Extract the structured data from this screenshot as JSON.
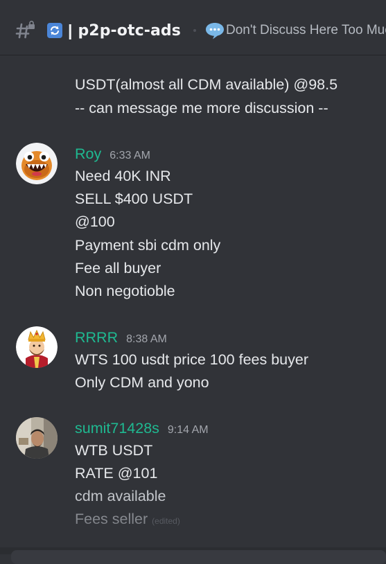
{
  "header": {
    "pipe": "|",
    "channel_name": "p2p-otc-ads",
    "topic": "Don't Discuss Here Too Muc",
    "icons": [
      "channel-hash-lock-icon",
      "refresh-emoji-icon",
      "speech-balloon-icon"
    ]
  },
  "messages": [
    {
      "continuation": true,
      "lines": [
        "USDT(almost all CDM available) @98.5",
        "-- can message me more discussion --"
      ]
    },
    {
      "username": "Roy",
      "timestamp": "6:33 AM",
      "avatar": "orange-monster-avatar",
      "lines": [
        "Need 40K INR",
        "SELL $400 USDT",
        "@100",
        "Payment sbi cdm only",
        "Fee all buyer",
        "Non negotioble"
      ]
    },
    {
      "username": "RRRR",
      "timestamp": "8:38 AM",
      "avatar": "king-character-avatar",
      "lines": [
        "WTS 100 usdt price 100 fees buyer",
        "Only CDM and yono"
      ]
    },
    {
      "username": "sumit71428s",
      "timestamp": "9:14 AM",
      "avatar": "person-photo-avatar",
      "lines": [
        "WTB USDT",
        "RATE @101",
        "cdm available",
        "Fees seller"
      ],
      "edited_label": "(edited)"
    }
  ],
  "colors": {
    "background": "#313338",
    "username": "#1fb991",
    "text": "#e6e8eb",
    "timestamp": "#a3a6ad"
  }
}
